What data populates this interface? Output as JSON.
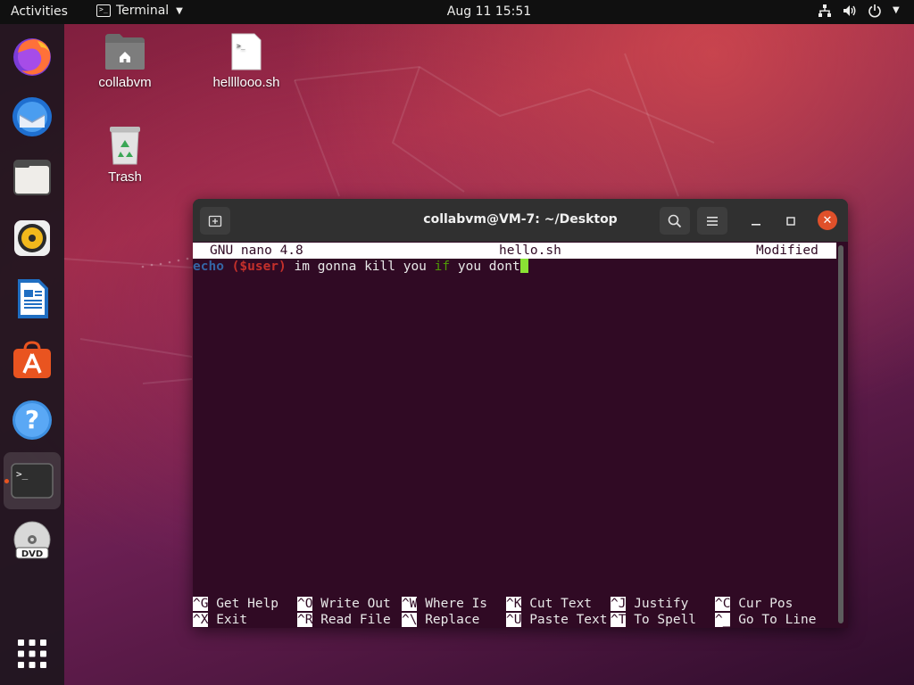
{
  "topbar": {
    "activities": "Activities",
    "app_name": "Terminal",
    "datetime": "Aug 11  15:51"
  },
  "dock": {
    "items": [
      {
        "name": "firefox-icon"
      },
      {
        "name": "thunderbird-icon"
      },
      {
        "name": "files-icon"
      },
      {
        "name": "rhythmbox-icon"
      },
      {
        "name": "libreoffice-writer-icon"
      },
      {
        "name": "software-center-icon"
      },
      {
        "name": "help-icon"
      },
      {
        "name": "terminal-icon",
        "active": true
      },
      {
        "name": "dvd-icon"
      },
      {
        "name": "show-applications-icon"
      }
    ]
  },
  "desktop": {
    "icons": [
      {
        "label": "collabvm",
        "icon": "home-folder-icon"
      },
      {
        "label": "hellllooo.sh",
        "icon": "script-file-icon"
      },
      {
        "label": "Trash",
        "icon": "trash-icon"
      }
    ]
  },
  "terminal": {
    "title": "collabvm@VM-7: ~/Desktop",
    "nano": {
      "version": "GNU nano 4.8",
      "filename": "hello.sh",
      "status": "Modified"
    },
    "code": {
      "echo": "echo",
      "paren_open": "(",
      "var": "$user",
      "paren_close": ")",
      "text1": " im gonna kill you ",
      "if": "if",
      "text2": " you dont"
    },
    "shortcuts": [
      {
        "key": "^G",
        "label": "Get Help"
      },
      {
        "key": "^O",
        "label": "Write Out"
      },
      {
        "key": "^W",
        "label": "Where Is"
      },
      {
        "key": "^K",
        "label": "Cut Text"
      },
      {
        "key": "^J",
        "label": "Justify"
      },
      {
        "key": "^C",
        "label": "Cur Pos"
      },
      {
        "key": "^X",
        "label": "Exit"
      },
      {
        "key": "^R",
        "label": "Read File"
      },
      {
        "key": "^\\",
        "label": "Replace"
      },
      {
        "key": "^U",
        "label": "Paste Text"
      },
      {
        "key": "^T",
        "label": "To Spell"
      },
      {
        "key": "^_",
        "label": "Go To Line"
      }
    ]
  },
  "colors": {
    "nano_background": "#300a24",
    "accent": "#e95420",
    "cursor": "#8ae234"
  }
}
